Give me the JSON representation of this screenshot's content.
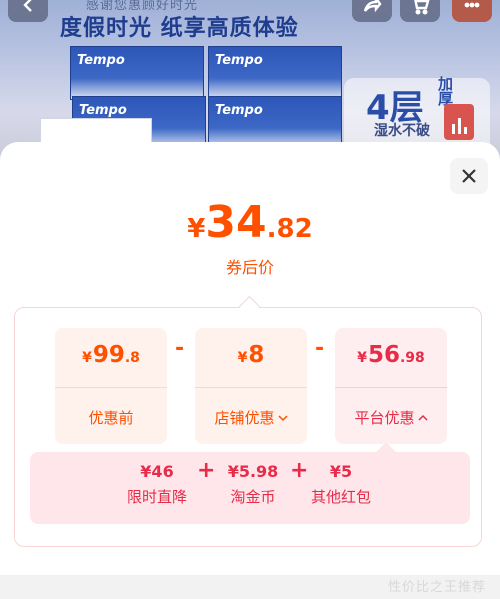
{
  "banner": {
    "subtitle": "感谢您惠顾好时光",
    "slogan": "度假时光 纸享高质体验",
    "brand": "Tempo",
    "feature_big": "4层",
    "feature_side": "加厚",
    "feature_note": "湿水不破"
  },
  "summary": {
    "currency": "¥",
    "price_int": "34",
    "price_dec": ".82",
    "label": "券后价"
  },
  "breakdown": {
    "original": {
      "currency": "¥",
      "int": "99",
      "dec": ".8",
      "label": "优惠前"
    },
    "shop": {
      "currency": "¥",
      "int": "8",
      "dec": "",
      "label": "店铺优惠",
      "chevron": "chevron-down-icon"
    },
    "platform": {
      "currency": "¥",
      "int": "56",
      "dec": ".98",
      "label": "平台优惠",
      "chevron": "chevron-up-icon"
    },
    "minus": "-"
  },
  "platform_detail": {
    "plus": "+",
    "items": [
      {
        "value": "¥46",
        "label": "限时直降"
      },
      {
        "value": "¥5.98",
        "label": "淘金币"
      },
      {
        "value": "¥5",
        "label": "其他红包"
      }
    ]
  },
  "footer": {
    "text": "性价比之王推荐"
  },
  "colors": {
    "accent": "#ff5000",
    "platform": "#e72b48"
  }
}
